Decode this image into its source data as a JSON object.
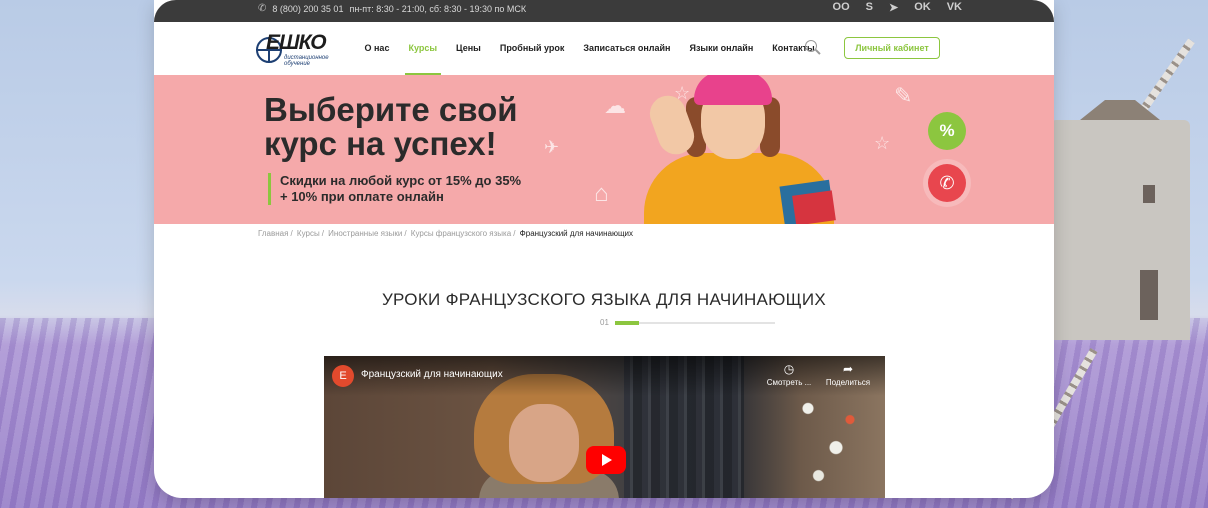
{
  "topbar": {
    "phone": "8 (800) 200 35 01",
    "hours": "пн-пт: 8:30 - 21:00, сб: 8:30 - 19:30 по МСК",
    "socials": [
      "OO",
      "S",
      "➤",
      "OK",
      "VK"
    ]
  },
  "logo": {
    "word": "ЕШКО",
    "sub": "дистанционное обучение"
  },
  "nav": {
    "items": [
      {
        "label": "О нас",
        "active": false
      },
      {
        "label": "Курсы",
        "active": true
      },
      {
        "label": "Цены",
        "active": false
      },
      {
        "label": "Пробный урок",
        "active": false
      },
      {
        "label": "Записаться онлайн",
        "active": false
      },
      {
        "label": "Языки онлайн",
        "active": false
      },
      {
        "label": "Контакты",
        "active": false
      }
    ],
    "cabinet_label": "Личный кабинет"
  },
  "banner": {
    "title_line1": "Выберите свой",
    "title_line2": "курс на успех!",
    "promo_line1": "Скидки на любой курс от 15% до 35%",
    "promo_line2": "+ 10% при оплате онлайн",
    "percent_badge": "%",
    "call_icon": "phone-icon"
  },
  "breadcrumbs": {
    "items": [
      "Главная",
      "Курсы",
      "Иностранные языки",
      "Курсы французского языка"
    ],
    "current": "Французский для начинающих"
  },
  "section": {
    "title": "УРОКИ ФРАНЦУЗСКОГО ЯЗЫКА ДЛЯ НАЧИНАЮЩИХ",
    "step": "01"
  },
  "video": {
    "channel_letter": "E",
    "title": "Французский для начинающих",
    "watch_later": "Смотреть ...",
    "share": "Поделиться"
  },
  "colors": {
    "accent": "#8cc63f",
    "banner": "#f5a9aa",
    "call": "#e8464e",
    "topbar": "#3b3b3b"
  }
}
